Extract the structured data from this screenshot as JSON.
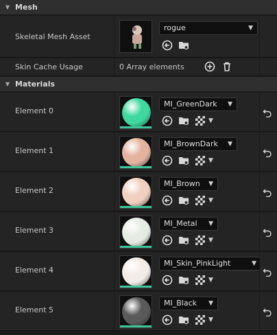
{
  "mesh_section": {
    "title": "Mesh"
  },
  "skeletal_mesh": {
    "label": "Skeletal Mesh Asset",
    "value": "rogue"
  },
  "skin_cache": {
    "label": "Skin Cache Usage",
    "value": "0 Array elements"
  },
  "materials_section": {
    "title": "Materials"
  },
  "elements": [
    {
      "label": "Element 0",
      "value": "MI_GreenDark",
      "color": "#3fd9a0"
    },
    {
      "label": "Element 1",
      "value": "MI_BrownDark",
      "color": "#e3b3a0"
    },
    {
      "label": "Element 2",
      "value": "MI_Brown",
      "color": "#f0cfc0"
    },
    {
      "label": "Element 3",
      "value": "MI_Metal",
      "color": "#e6ece4"
    },
    {
      "label": "Element 4",
      "value": "MI_Skin_PinkLight",
      "color": "#f1ece8"
    },
    {
      "label": "Element 5",
      "value": "MI_Black",
      "color": "#5a5a5a"
    }
  ],
  "colors": {
    "accent_bar": "#3fc69a",
    "panel": "#242424",
    "header": "#2f2f2f"
  }
}
